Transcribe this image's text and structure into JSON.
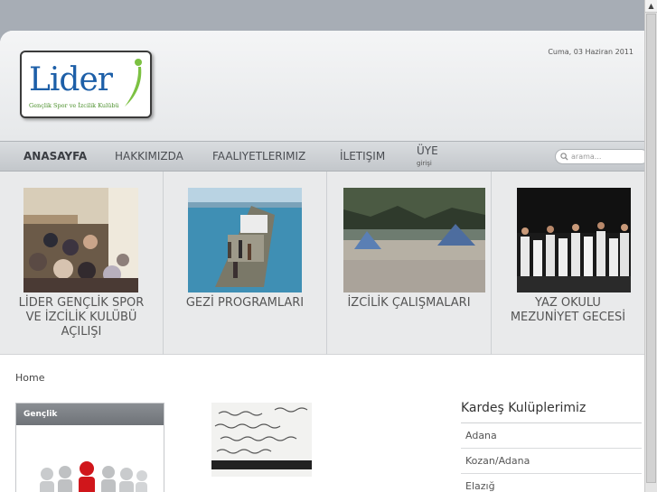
{
  "header": {
    "date": "Cuma, 03 Haziran 2011",
    "logo": {
      "word": "Lider",
      "tagline": "Gençlik Spor ve İzcilik Kulübü"
    }
  },
  "nav": {
    "items": [
      {
        "label": "ANASAYFA",
        "active": true
      },
      {
        "label": "HAKKIMIZDA",
        "active": false
      },
      {
        "label": "FAALIYETLERIMIZ",
        "active": false
      },
      {
        "label": "İLETIŞIM",
        "active": false
      },
      {
        "label": "ÜYE",
        "active": false,
        "sublabel": "girişi"
      }
    ],
    "search_placeholder": "arama..."
  },
  "features": [
    {
      "caption": "LİDER GENÇLİK SPOR VE İZCİLİK KULÜBÜ AÇILIŞI"
    },
    {
      "caption": "GEZİ PROGRAMLARI"
    },
    {
      "caption": "İZCİLİK ÇALIŞMALARI"
    },
    {
      "caption": "YAZ OKULU MEZUNİYET GECESİ"
    }
  ],
  "breadcrumb": "Home",
  "left_box": {
    "title": "Gençlik"
  },
  "sidebar": {
    "title": "Kardeş Kulüplerimiz",
    "items": [
      "Adana",
      "Kozan/Adana",
      "Elazığ"
    ]
  },
  "colors": {
    "nav_bg": "#c9cccf",
    "logo_blue": "#1d5fa8",
    "logo_green": "#4a8f2a",
    "box_header": "#7a7e83"
  }
}
